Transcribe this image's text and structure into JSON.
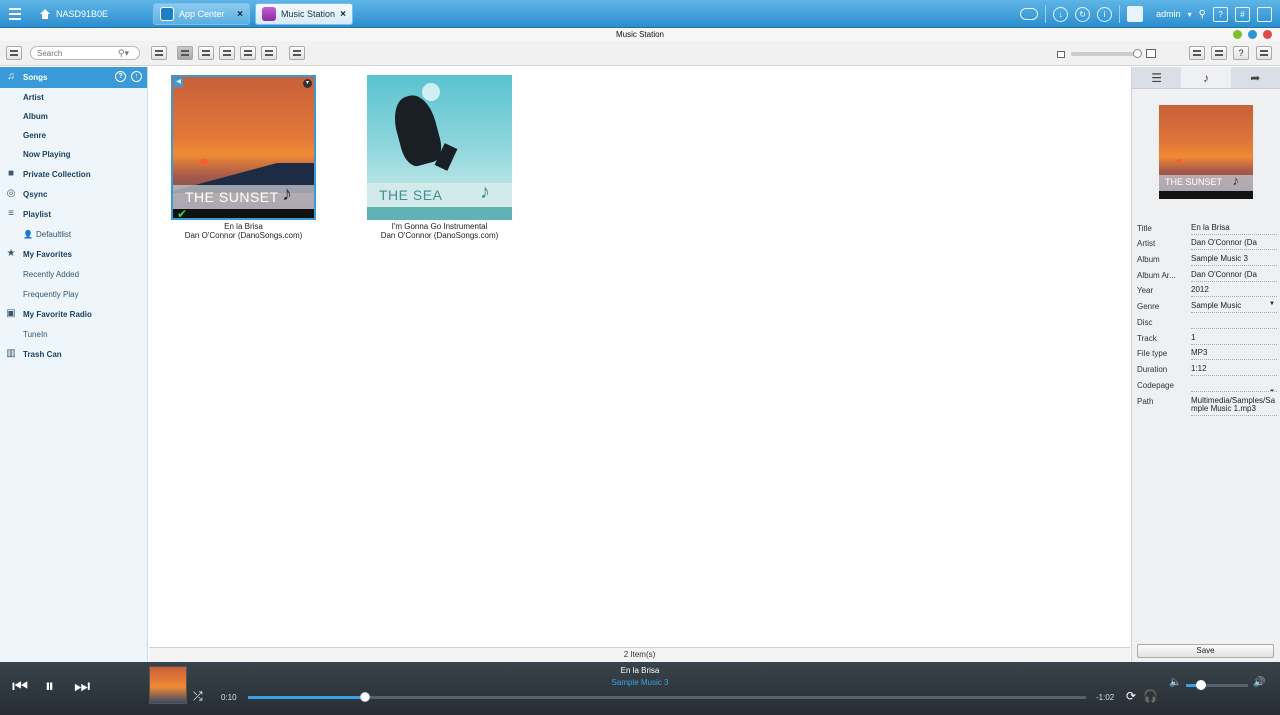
{
  "topbar": {
    "host": "NASD91B0E",
    "tabs": [
      {
        "label": "App Center",
        "close": "×"
      },
      {
        "label": "Music Station",
        "close": "×"
      }
    ],
    "user": "admin"
  },
  "window": {
    "title": "Music Station"
  },
  "toolbar": {
    "search_placeholder": "Search"
  },
  "sidebar": {
    "songs": "Songs",
    "artist": "Artist",
    "album": "Album",
    "genre": "Genre",
    "now_playing": "Now Playing",
    "private_collection": "Private Collection",
    "qsync": "Qsync",
    "playlist": "Playlist",
    "defaultlist": "Defaultlist",
    "my_favorites": "My Favorites",
    "recently_added": "Recently Added",
    "frequently_play": "Frequently Play",
    "my_favorite_radio": "My Favorite Radio",
    "tunein": "TuneIn",
    "trash_can": "Trash Can"
  },
  "songs": [
    {
      "title": "En la Brisa",
      "artist": "Dan O'Connor (DanoSongs.com)",
      "art_text": "THE SUNSET"
    },
    {
      "title": "I'm Gonna Go Instrumental",
      "artist": "Dan O'Connor (DanoSongs.com)",
      "art_text": "THE SEA"
    }
  ],
  "status": {
    "count": "2 Item(s)"
  },
  "details": {
    "art_text": "THE SUNSET",
    "labels": {
      "title": "Title",
      "artist": "Artist",
      "album": "Album",
      "album_artist": "Album Ar...",
      "year": "Year",
      "genre": "Genre",
      "disc": "Disc",
      "track": "Track",
      "file_type": "File type",
      "duration": "Duration",
      "codepage": "Codepage",
      "path": "Path"
    },
    "values": {
      "title": "En la Brisa",
      "artist": "Dan O'Connor (Da",
      "album": "Sample Music 3",
      "album_artist": "Dan O'Connor (Da",
      "year": "2012",
      "genre": "Sample Music",
      "disc": "",
      "track": "1",
      "file_type": "MP3",
      "duration": "1:12",
      "codepage": "",
      "path": "Multimedia/Samples/Sample Music 1.mp3"
    },
    "save": "Save"
  },
  "player": {
    "title": "En la Brisa",
    "album": "Sample Music 3",
    "elapsed": "0:10",
    "remaining": "-1:02",
    "progress_fraction": 0.14,
    "volume_fraction": 0.24
  },
  "colors": {
    "accent": "#3a9ad9",
    "topbar": "#2c8ed0",
    "player_bg": "#2c343a"
  }
}
